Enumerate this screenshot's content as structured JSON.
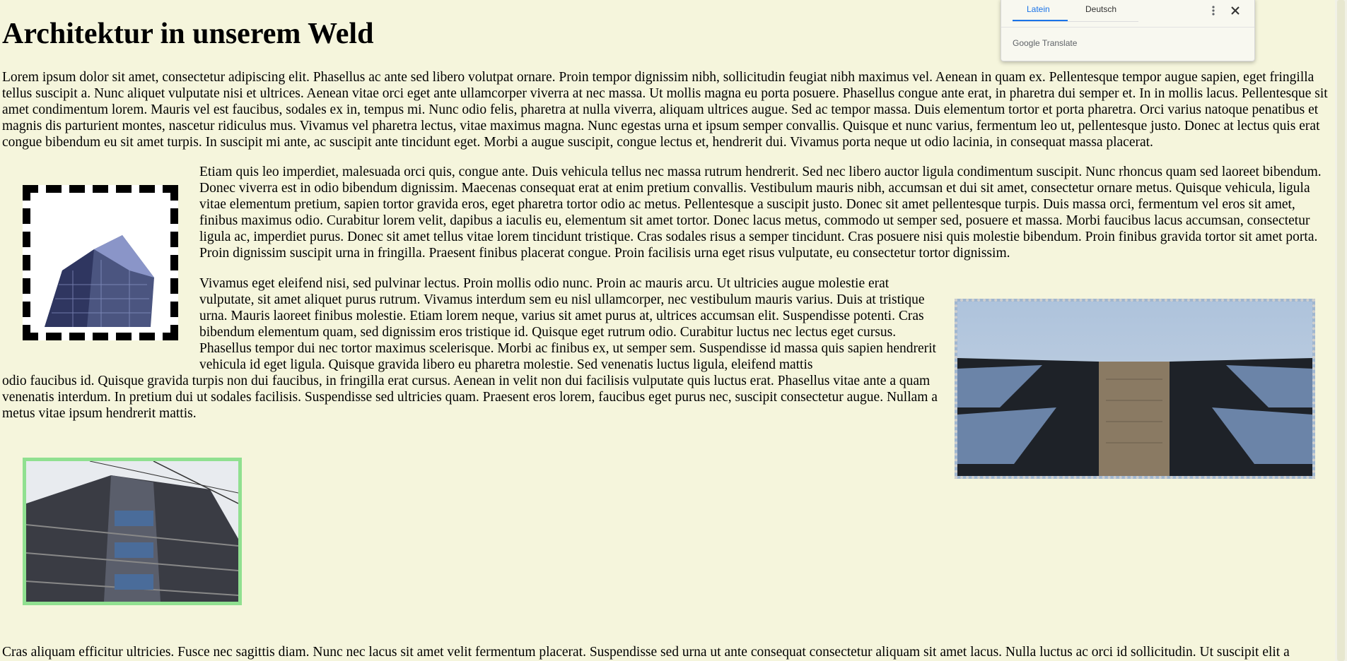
{
  "page": {
    "title": "Architektur in unserem Weld",
    "paragraphs": [
      "Lorem ipsum dolor sit amet, consectetur adipiscing elit. Phasellus ac ante sed libero volutpat ornare. Proin tempor dignissim nibh, sollicitudin feugiat nibh maximus vel. Aenean in quam ex. Pellentesque tempor augue sapien, eget fringilla tellus suscipit a. Nunc aliquet vulputate nisi et ultrices. Aenean vitae orci eget ante ullamcorper viverra at nec massa. Ut mollis magna eu porta posuere. Phasellus congue ante erat, in pharetra dui semper et. In in mollis lacus. Pellentesque sit amet condimentum lorem. Mauris vel est faucibus, sodales ex in, tempus mi. Nunc odio felis, pharetra at nulla viverra, aliquam ultrices augue. Sed ac tempor massa. Duis elementum tortor et porta pharetra. Orci varius natoque penatibus et magnis dis parturient montes, nascetur ridiculus mus. Vivamus vel pharetra lectus, vitae maximus magna. Nunc egestas urna et ipsum semper convallis. Quisque et nunc varius, fermentum leo ut, pellentesque justo. Donec at lectus quis erat congue bibendum eu sit amet turpis. In suscipit mi ante, ac suscipit ante tincidunt eget. Morbi a augue suscipit, congue lectus et, hendrerit dui. Vivamus porta neque ut odio lacinia, in consequat massa placerat.",
      "Etiam quis leo imperdiet, malesuada orci quis, congue ante. Duis vehicula tellus nec massa rutrum hendrerit. Sed nec libero auctor ligula condimentum suscipit. Nunc rhoncus quam sed laoreet bibendum. Donec viverra est in odio bibendum dignissim. Maecenas consequat erat at enim pretium convallis. Vestibulum mauris nibh, accumsan et dui sit amet, consectetur ornare metus. Quisque vehicula, ligula vitae elementum pretium, sapien tortor gravida eros, eget pharetra tortor odio ac metus. Pellentesque a suscipit justo. Donec sit amet pellentesque turpis. Duis massa orci, fermentum vel eros sit amet, finibus maximus odio. Curabitur lorem velit, dapibus a iaculis eu, elementum sit amet tortor. Donec lacus metus, commodo ut semper sed, posuere et massa. Morbi faucibus lacus accumsan, consectetur ligula ac, imperdiet purus. Donec sit amet tellus vitae lorem tincidunt tristique. Cras sodales risus a semper tincidunt. Cras posuere nisi quis molestie bibendum. Proin finibus gravida tortor sit amet porta. Proin dignissim suscipit urna in fringilla. Praesent finibus placerat congue. Proin facilisis urna eget risus vulputate, eu consectetur tortor dignissim.",
      "Vivamus eget eleifend nisi, sed pulvinar lectus. Proin mollis odio nunc. Proin ac mauris arcu. Ut ultricies augue molestie erat vulputate, sit amet aliquet purus rutrum. Vivamus interdum sem eu nisl ullamcorper, nec vestibulum mauris varius. Duis at tristique urna. Mauris laoreet finibus molestie. Etiam lorem neque, varius sit amet purus at, ultrices accumsan elit. Suspendisse potenti. Cras bibendum elementum quam, sed dignissim eros tristique id. Quisque eget rutrum odio. Curabitur luctus nec lectus eget cursus. Phasellus tempor dui nec tortor maximus scelerisque. Morbi ac finibus ex, ut semper sem. Suspendisse id massa quis sapien hendrerit vehicula id eget ligula. Quisque gravida libero eu pharetra molestie. Sed venenatis luctus ligula, eleifend mattis",
      "odio faucibus id. Quisque gravida turpis non dui faucibus, in fringilla erat cursus. Aenean in velit non dui facilisis vulputate quis luctus erat. Phasellus vitae ante a quam venenatis interdum. In pretium dui ut sodales facilisis. Suspendisse sed ultricies quam. Praesent eros lorem, faucibus eget purus nec, suscipit consectetur augue. Nullam a metus vitae ipsum hendrerit mattis.",
      "Cras aliquam efficitur ultricies. Fusce nec sagittis diam. Nunc nec lacus sit amet velit fermentum placerat. Suspendisse sed urna ut ante consequat consectetur aliquam sit amet lacus. Nulla luctus ac orci id sollicitudin. Ut suscipit elit a"
    ]
  },
  "translate": {
    "tabs": [
      "Latein",
      "Deutsch"
    ],
    "active_tab": "Latein",
    "brand_google": "Google",
    "brand_translate": "Translate",
    "icons": [
      "more-vert-icon",
      "close-icon"
    ]
  },
  "colors": {
    "page_background": "#f5f5dc",
    "accent": "#1a73e8",
    "green_border": "#90e090"
  }
}
